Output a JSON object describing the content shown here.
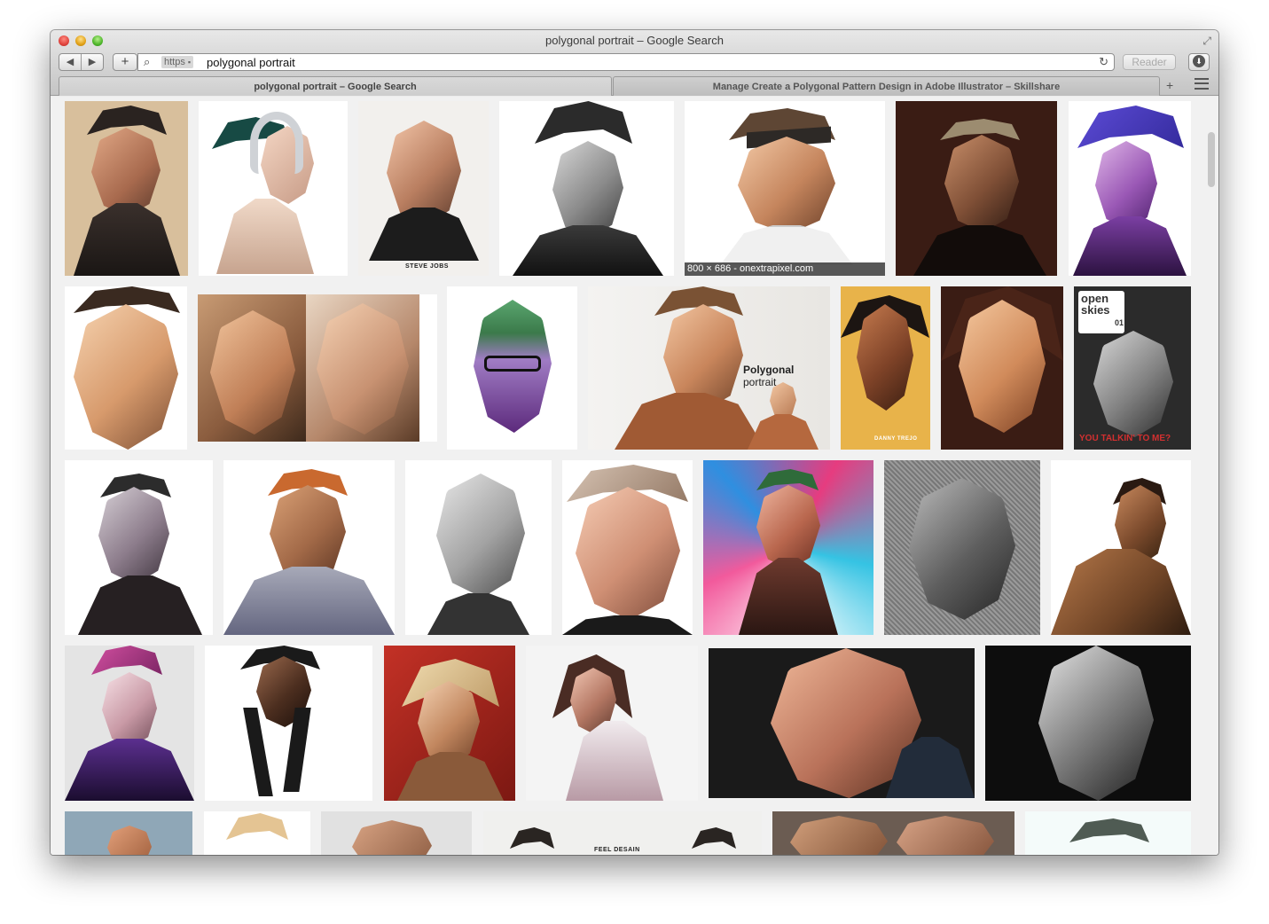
{
  "window": {
    "title": "polygonal portrait – Google Search"
  },
  "toolbar": {
    "back_icon": "◀",
    "forward_icon": "▶",
    "add_icon": "+",
    "search_icon": "🔍",
    "https_label": "https",
    "lock_icon": "🔒",
    "url": "polygonal portrait",
    "reload_icon": "↻",
    "reader_label": "Reader"
  },
  "tabs": [
    {
      "label": "polygonal portrait – Google Search"
    },
    {
      "label": "Manage Create a Polygonal Pattern Design in Adobe Illustrator – Skillshare"
    }
  ],
  "tabbar": {
    "new_tab_icon": "+"
  },
  "results": {
    "hover_caption": "800 × 686 - onextrapixel.com",
    "steve_caption": "STEVE JOBS",
    "polygonal_label_bold": "Polygonal",
    "polygonal_label_rest": " portrait",
    "danny_caption": "DANNY TREJO",
    "open_skies_title": "open skies",
    "open_skies_num": "01",
    "talkin_caption": "YOU TALKIN' TO ME?",
    "feel_caption": "FEEL DESAIN"
  },
  "colors": {
    "accent": "#3b7ddd",
    "titlebar_top": "#e8e8e8",
    "titlebar_bottom": "#c4c4c4"
  }
}
